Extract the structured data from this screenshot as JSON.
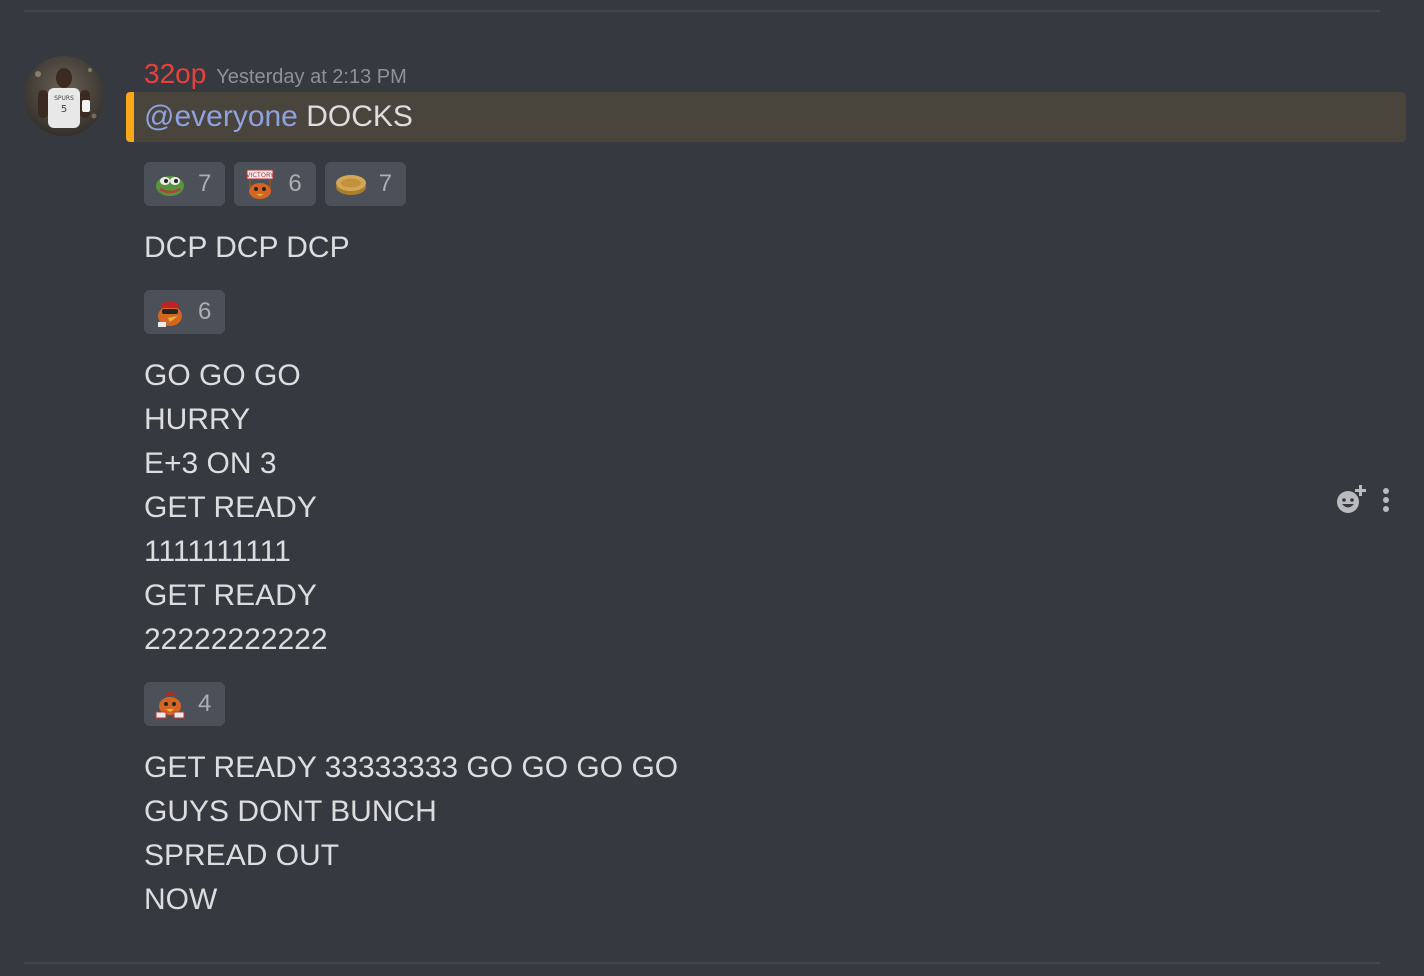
{
  "message": {
    "username": "32op",
    "timestamp": "Yesterday at 2:13 PM",
    "username_color": "#e8413c",
    "mention_highlight_color": "#faa81a",
    "first_line": {
      "mention": "@everyone",
      "text": "DOCKS"
    },
    "reactions_1": [
      {
        "emoji": "pepe-frog-icon",
        "count": "7"
      },
      {
        "emoji": "victory-icon",
        "count": "6"
      },
      {
        "emoji": "cookie-icon",
        "count": "7"
      }
    ],
    "text_2": [
      "DCP DCP DCP"
    ],
    "reactions_2": [
      {
        "emoji": "chicken-icon",
        "count": "6"
      }
    ],
    "text_3": [
      "GO GO GO",
      "HURRY",
      "E+3 ON 3",
      "GET READY",
      "1111111111",
      "GET READY",
      "22222222222"
    ],
    "reactions_3": [
      {
        "emoji": "chicken-dance-icon",
        "count": "4"
      }
    ],
    "text_4": [
      "GET READY 33333333 GO GO GO GO",
      "GUYS DONT BUNCH",
      "SPREAD OUT",
      "NOW"
    ]
  },
  "actions": {
    "add_reaction": "add-reaction-icon",
    "more": "more-options-icon"
  }
}
